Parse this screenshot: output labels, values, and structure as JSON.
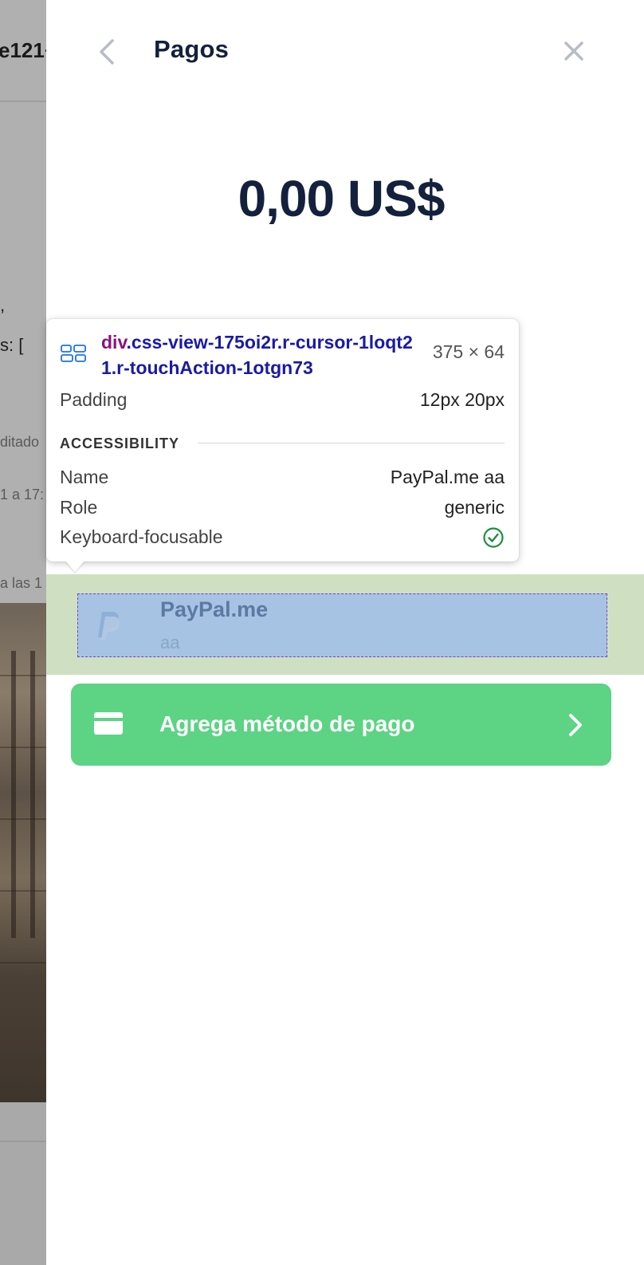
{
  "background_page": {
    "header_fragment": "e121+",
    "code_lines": [
      ",",
      "s: ["
    ],
    "meta_lines": [
      "ditado",
      "1 a 17:",
      "a las 1"
    ],
    "photo": "room-photo"
  },
  "drawer": {
    "title": "Pagos",
    "back_icon": "chevron-left-icon",
    "close_icon": "close-icon",
    "balance": "0,00 US$"
  },
  "payment_methods": [
    {
      "icon": "paypal-icon",
      "name": "PayPal.me",
      "sub": "aa"
    }
  ],
  "add_payment": {
    "label": "Agrega método de pago",
    "icon": "credit-card-icon",
    "chevron": "chevron-right-icon"
  },
  "devtools_tooltip": {
    "tag": "div",
    "selector": ".css-view-175oi2r.r-cursor-1loqt21.r-touchAction-1otgn73",
    "size": "375 × 64",
    "padding_label": "Padding",
    "padding_value": "12px 20px",
    "section": "ACCESSIBILITY",
    "name_label": "Name",
    "name_value": "PayPal.me aa",
    "role_label": "Role",
    "role_value": "generic",
    "focusable_label": "Keyboard-focusable",
    "focusable_value": true
  },
  "colors": {
    "title": "#14213d",
    "add_button": "#5dd384",
    "highlight_margin": "#cfe0c2",
    "highlight_content": "#a7c3e3"
  }
}
